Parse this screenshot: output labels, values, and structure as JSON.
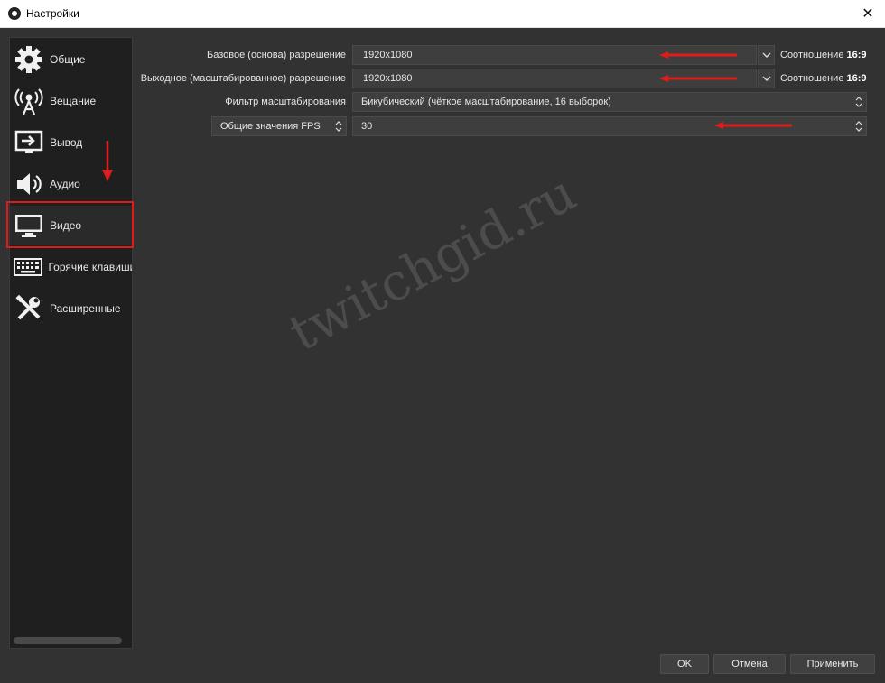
{
  "window": {
    "title": "Настройки",
    "close_glyph": "✕",
    "icon": "obs-logo-icon"
  },
  "sidebar": {
    "items": [
      {
        "label": "Общие",
        "icon": "gear-icon"
      },
      {
        "label": "Вещание",
        "icon": "broadcast-antenna-icon"
      },
      {
        "label": "Вывод",
        "icon": "output-monitor-icon"
      },
      {
        "label": "Аудио",
        "icon": "speaker-icon"
      },
      {
        "label": "Видео",
        "icon": "monitor-icon",
        "selected": true
      },
      {
        "label": "Горячие клавиши",
        "icon": "keyboard-icon"
      },
      {
        "label": "Расширенные",
        "icon": "tools-icon"
      }
    ]
  },
  "video": {
    "base_resolution": {
      "label": "Базовое (основа) разрешение",
      "value": "1920x1080",
      "ratio_label": "Соотношение",
      "ratio_value": "16:9"
    },
    "output_resolution": {
      "label": "Выходное (масштабированное) разрешение",
      "value": "1920x1080",
      "ratio_label": "Соотношение",
      "ratio_value": "16:9"
    },
    "downscale_filter": {
      "label": "Фильтр масштабирования",
      "value": "Бикубический (чёткое масштабирование, 16 выборок)"
    },
    "fps": {
      "type_label": "Общие значения FPS",
      "value": "30"
    }
  },
  "watermark": "twitchgid.ru",
  "buttons": {
    "ok": "OK",
    "cancel": "Отмена",
    "apply": "Применить"
  },
  "colors": {
    "highlight_red": "#e01b1b",
    "background": "#323232",
    "sidebar": "#1f1f1f"
  }
}
